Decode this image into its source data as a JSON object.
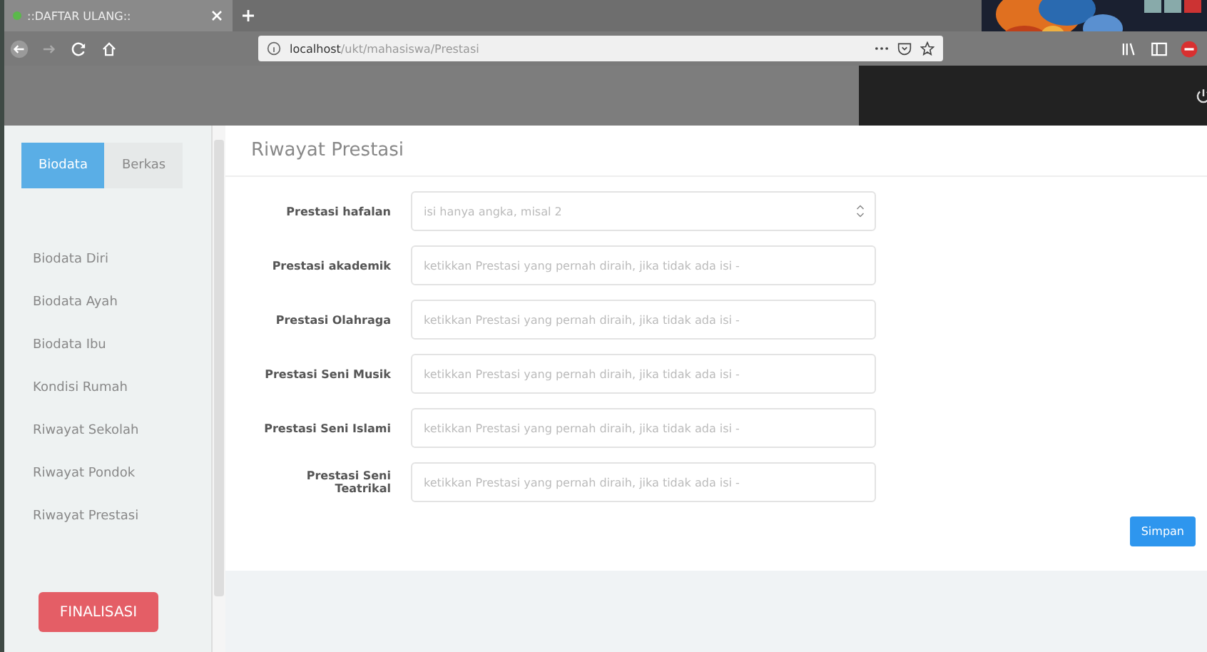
{
  "browser": {
    "tab_title": "::DAFTAR ULANG::",
    "url_host": "localhost",
    "url_path": "/ukt/mahasiswa/Prestasi"
  },
  "sidebar": {
    "tabs": [
      {
        "label": "Biodata",
        "selected": true
      },
      {
        "label": "Berkas",
        "selected": false
      }
    ],
    "items": [
      {
        "label": "Biodata Diri"
      },
      {
        "label": "Biodata Ayah"
      },
      {
        "label": "Biodata Ibu"
      },
      {
        "label": "Kondisi Rumah"
      },
      {
        "label": "Riwayat Sekolah"
      },
      {
        "label": "Riwayat Pondok"
      },
      {
        "label": "Riwayat Prestasi"
      }
    ],
    "finalize_button": "FINALISASI"
  },
  "form": {
    "title": "Riwayat Prestasi",
    "fields": [
      {
        "label": "Prestasi hafalan",
        "kind": "number",
        "placeholder": "isi hanya angka, misal 2"
      },
      {
        "label": "Prestasi akademik",
        "kind": "text",
        "placeholder": "ketikkan Prestasi yang pernah diraih, jika tidak ada isi -"
      },
      {
        "label": "Prestasi Olahraga",
        "kind": "text",
        "placeholder": "ketikkan Prestasi yang pernah diraih, jika tidak ada isi -"
      },
      {
        "label": "Prestasi Seni Musik",
        "kind": "text",
        "placeholder": "ketikkan Prestasi yang pernah diraih, jika tidak ada isi -"
      },
      {
        "label": "Prestasi Seni Islami",
        "kind": "text",
        "placeholder": "ketikkan Prestasi yang pernah diraih, jika tidak ada isi -"
      },
      {
        "label": "Prestasi Seni Teatrikal",
        "kind": "text",
        "placeholder": "ketikkan Prestasi yang pernah diraih, jika tidak ada isi -"
      }
    ],
    "save_button": "Simpan"
  }
}
